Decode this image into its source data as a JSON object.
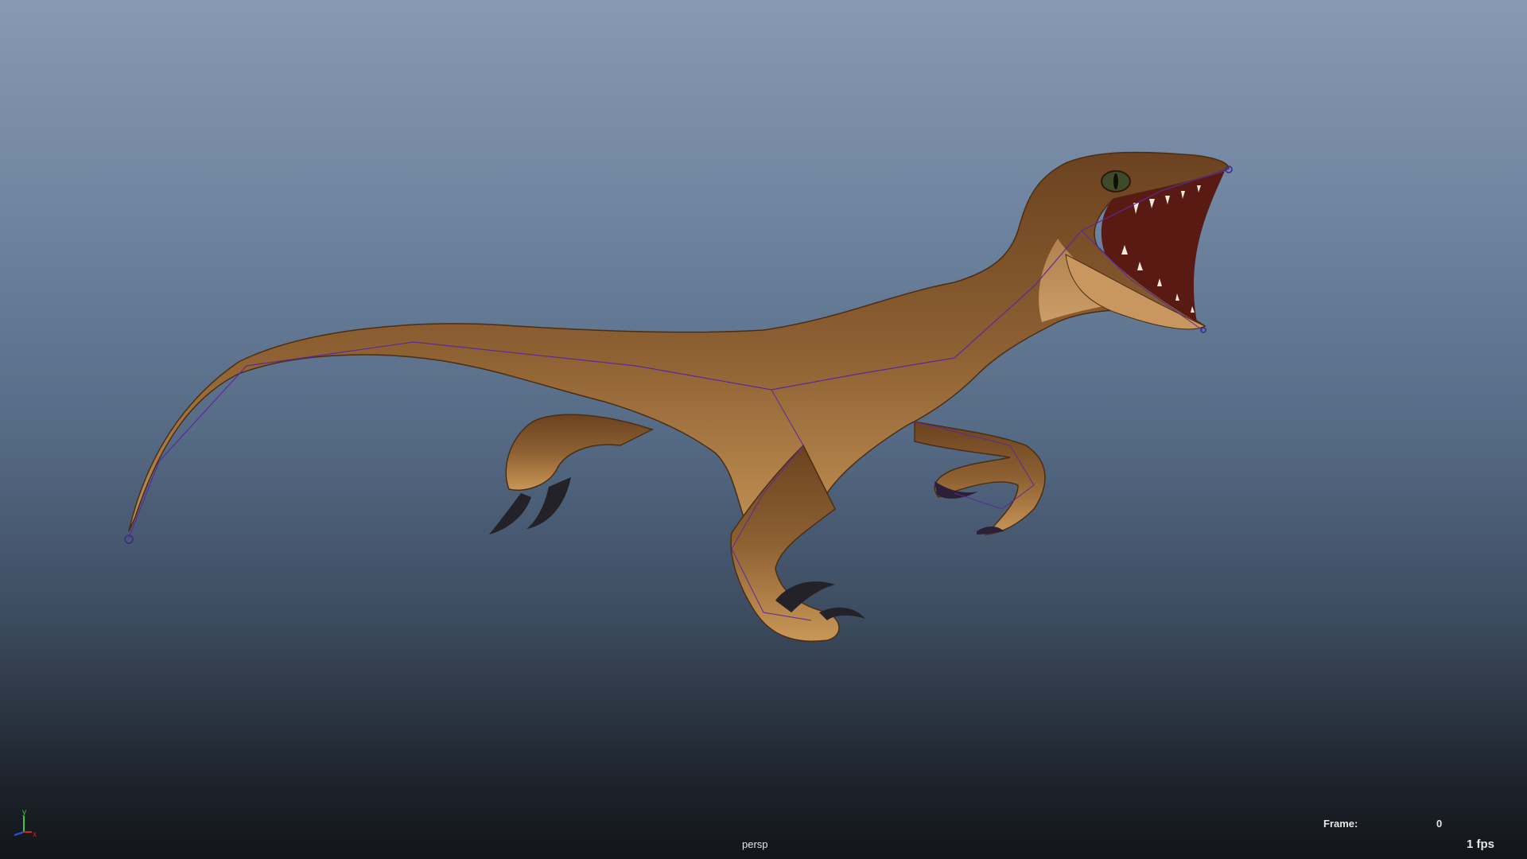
{
  "viewport": {
    "camera": "persp",
    "frame_label": "Frame:",
    "frame_value": "0",
    "fps": "1 fps"
  },
  "axis_gizmo": {
    "x_label": "x",
    "y_label": "y",
    "x_color": "#d22020",
    "y_color": "#3ec83e",
    "z_color": "#3050e0"
  },
  "model": {
    "icon": "velociraptor-model",
    "skin_color": "#8a5c2c",
    "belly_color": "#d9a86a",
    "claw_color": "#222228",
    "rig_color": "#5a2a9a"
  }
}
